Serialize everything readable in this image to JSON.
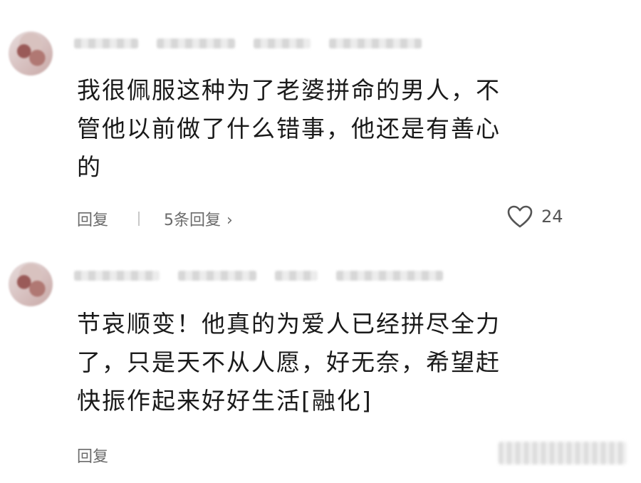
{
  "comments": [
    {
      "username": "",
      "lines": [
        "我很佩服这种为了老婆拼命的男人，不",
        "管他以前做了什么错事，他还是有善心",
        "的"
      ],
      "reply_label": "回复",
      "replies_label": "5条回复",
      "like_count": "24"
    },
    {
      "username": "",
      "lines": [
        "节哀顺变！他真的为爱人已经拼尽全力",
        "了，只是天不从人愿，好无奈，希望赶",
        "快振作起来好好生活[融化]"
      ],
      "reply_label": "回复"
    }
  ],
  "icons": {
    "like": "heart-icon",
    "replies_arrow": "chevron-right-icon"
  },
  "colors": {
    "text": "#1a1a1a",
    "secondary": "#6b6b6b",
    "background": "#ffffff"
  }
}
